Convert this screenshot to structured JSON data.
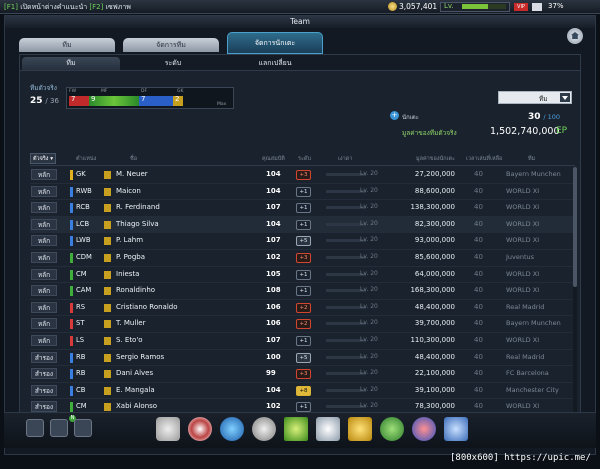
{
  "topbar": {
    "notice": "เปิดหน้าต่างคำแนะนำ",
    "notice_tag1": "[F1]",
    "notice_tag2": "[F2]",
    "notice_extra": "เซฟภาพ",
    "coins": "3,057,401",
    "level_label": "Lv.",
    "level_value": "",
    "vip": "VIP",
    "percent": "37%"
  },
  "window": {
    "title": "Team",
    "tabs": [
      "ทีม",
      "จัดการทีม",
      "จัดการนักเตะ"
    ],
    "active_tab": 2
  },
  "subtabs": [
    "ทีม",
    "ระดับ",
    "แลกเปลี่ยน"
  ],
  "squad": {
    "label": "ทีมตัวจริง",
    "count": "25",
    "max": "/ 36",
    "fw_label": "FW",
    "mf_label": "MF",
    "df_label": "DF",
    "gk_label": "GK",
    "fw_count": "7",
    "mf_count": "9",
    "df_count": "7",
    "gk_count": "2",
    "max_label": "Max"
  },
  "dropdown": {
    "value": "ทีม"
  },
  "add_player_label": "นักเตะ",
  "players_count": "30",
  "players_max": "/ 100",
  "team_value_label": "มูลค่าของทีมตัวจริง",
  "team_value": "1,502,740,000",
  "team_value_unit": "EP",
  "table": {
    "headers": {
      "role": "ตัวจริง ▾",
      "position": "ตำแหน่ง",
      "name": "ชื่อ",
      "ovr": "คุณสมบัติ",
      "level": "ระดับ",
      "condition": "เงาดา",
      "lv": "",
      "price": "มูลค่าของนักเตะ",
      "age": "เวลาเล่นที่เหลือ",
      "club": "ทีม"
    },
    "rows": [
      {
        "role": "หลัก",
        "pos": "GK",
        "color": "#e0b020",
        "name": "M. Neuer",
        "ovr": "104",
        "lvl": "+3",
        "lvtype": "red",
        "lv": "Lv. 20",
        "price": "27,200,000",
        "age": "40",
        "club": "Bayern Munchen"
      },
      {
        "role": "หลัก",
        "pos": "RWB",
        "color": "#3a7fe0",
        "name": "Maicon",
        "ovr": "104",
        "lvl": "+1",
        "lvtype": "",
        "lv": "Lv. 20",
        "price": "88,600,000",
        "age": "40",
        "club": "WORLD XI"
      },
      {
        "role": "หลัก",
        "pos": "RCB",
        "color": "#3a7fe0",
        "name": "R. Ferdinand",
        "ovr": "107",
        "lvl": "+1",
        "lvtype": "",
        "lv": "Lv. 20",
        "price": "138,300,000",
        "age": "40",
        "club": "WORLD XI"
      },
      {
        "role": "หลัก",
        "pos": "LCB",
        "color": "#3a7fe0",
        "name": "Thiago Silva",
        "ovr": "104",
        "lvl": "+1",
        "lvtype": "",
        "lv": "Lv. 20",
        "price": "82,300,000",
        "age": "40",
        "club": "WORLD XI"
      },
      {
        "role": "หลัก",
        "pos": "LWB",
        "color": "#3a7fe0",
        "name": "P. Lahm",
        "ovr": "107",
        "lvl": "+5",
        "lvtype": "grey",
        "lv": "Lv. 20",
        "price": "93,000,000",
        "age": "40",
        "club": "WORLD XI"
      },
      {
        "role": "หลัก",
        "pos": "CDM",
        "color": "#3fae3a",
        "name": "P. Pogba",
        "ovr": "102",
        "lvl": "+3",
        "lvtype": "red",
        "lv": "Lv. 20",
        "price": "85,600,000",
        "age": "40",
        "club": "Juventus"
      },
      {
        "role": "หลัก",
        "pos": "CM",
        "color": "#3fae3a",
        "name": "Iniesta",
        "ovr": "105",
        "lvl": "+1",
        "lvtype": "",
        "lv": "Lv. 20",
        "price": "64,000,000",
        "age": "40",
        "club": "WORLD XI"
      },
      {
        "role": "หลัก",
        "pos": "CAM",
        "color": "#3fae3a",
        "name": "Ronaldinho",
        "ovr": "108",
        "lvl": "+1",
        "lvtype": "",
        "lv": "Lv. 20",
        "price": "168,300,000",
        "age": "40",
        "club": "WORLD XI"
      },
      {
        "role": "หลัก",
        "pos": "RS",
        "color": "#d83a3a",
        "name": "Cristiano Ronaldo",
        "ovr": "106",
        "lvl": "+2",
        "lvtype": "red",
        "lv": "Lv. 20",
        "price": "48,400,000",
        "age": "40",
        "club": "Real Madrid"
      },
      {
        "role": "หลัก",
        "pos": "ST",
        "color": "#d83a3a",
        "name": "T. Muller",
        "ovr": "106",
        "lvl": "+2",
        "lvtype": "red",
        "lv": "Lv. 20",
        "price": "39,700,000",
        "age": "40",
        "club": "Bayern Munchen"
      },
      {
        "role": "หลัก",
        "pos": "LS",
        "color": "#d83a3a",
        "name": "S. Eto'o",
        "ovr": "107",
        "lvl": "+1",
        "lvtype": "",
        "lv": "Lv. 20",
        "price": "110,300,000",
        "age": "40",
        "club": "WORLD XI"
      },
      {
        "role": "สำรอง",
        "pos": "RB",
        "color": "#3a7fe0",
        "name": "Sergio Ramos",
        "ovr": "100",
        "lvl": "+5",
        "lvtype": "grey",
        "lv": "Lv. 20",
        "price": "48,400,000",
        "age": "40",
        "club": "Real Madrid"
      },
      {
        "role": "สำรอง",
        "pos": "RB",
        "color": "#3a7fe0",
        "name": "Dani Alves",
        "ovr": "99",
        "lvl": "+3",
        "lvtype": "red",
        "lv": "Lv. 20",
        "price": "22,100,000",
        "age": "40",
        "club": "FC Barcelona"
      },
      {
        "role": "สำรอง",
        "pos": "CB",
        "color": "#3a7fe0",
        "name": "E. Mangala",
        "ovr": "104",
        "lvl": "+8",
        "lvtype": "gold",
        "lv": "Lv. 20",
        "price": "39,100,000",
        "age": "40",
        "club": "Manchester City"
      },
      {
        "role": "สำรอง",
        "pos": "CM",
        "color": "#3fae3a",
        "name": "Xabi Alonso",
        "ovr": "102",
        "lvl": "+1",
        "lvtype": "",
        "lv": "Lv. 20",
        "price": "78,300,000",
        "age": "40",
        "club": "WORLD XI"
      }
    ]
  },
  "dock": {
    "badge": "N"
  },
  "watermark": "[800x600] https://upic.me/",
  "colors": {
    "accent": "#4aa0c8",
    "value_green": "#6fd35a"
  }
}
